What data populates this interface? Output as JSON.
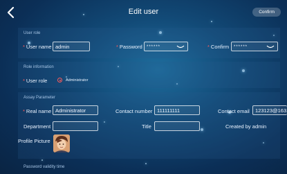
{
  "header": {
    "title": "Edit user",
    "confirm_label": "Confirm"
  },
  "user_role_section": {
    "heading": "User role",
    "user_name_label": "User name",
    "user_name_value": "admin",
    "password_label": "Password",
    "password_value": "******",
    "confirm_label": "Confirm",
    "confirm_value": "******"
  },
  "role_info_section": {
    "heading": "Role information",
    "user_role_label": "User role",
    "role_option": "Administrator"
  },
  "assay_section": {
    "heading": "Assay Parameter",
    "real_name_label": "Real name",
    "real_name_value": "Administrator",
    "contact_number_label": "Contact number",
    "contact_number_value": "111111111",
    "contact_email_label": "Contact email",
    "contact_email_value": "123123@163.",
    "department_label": "Department",
    "department_value": "",
    "title_label": "Title",
    "title_value": "",
    "created_by_label": "Created by",
    "created_by_value": "admin",
    "profile_picture_label": "Profile Picture"
  },
  "footer": {
    "password_validity_label": "Password validity time"
  },
  "icons": {
    "back": "chevron-left-icon",
    "eye": "eye-closed-icon"
  }
}
